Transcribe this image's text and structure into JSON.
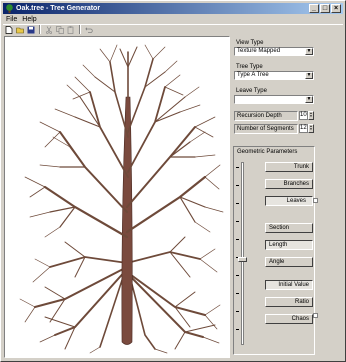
{
  "window": {
    "title": "Oak.tree - Tree Generator"
  },
  "title_controls": [
    "_",
    "□",
    "×"
  ],
  "menu": [
    "File",
    "Help"
  ],
  "toolbar": [
    "new-file-icon",
    "open-folder-icon",
    "save-icon",
    "cut-icon",
    "copy-icon",
    "paste-icon",
    "undo-icon"
  ],
  "panel": {
    "view_type_label": "View Type",
    "view_type_value": "Texture Mapped",
    "tree_type_label": "Tree Type",
    "tree_type_value": "Type A Tree",
    "leave_type_label": "Leave Type",
    "leave_type_value": "",
    "recursion_label": "Recursion Depth",
    "recursion_value": "10",
    "segments_label": "Number of Segments",
    "segments_value": "12",
    "geom_label": "Geometric Parameters",
    "buttons": {
      "trunk": "Trunk",
      "branches": "Branches",
      "leaves": "Leaves",
      "section": "Section",
      "length": "Length",
      "angle": "Angle",
      "initial_value": "Initial Value",
      "ratio": "Ratio",
      "chaos": "Chaos"
    }
  }
}
